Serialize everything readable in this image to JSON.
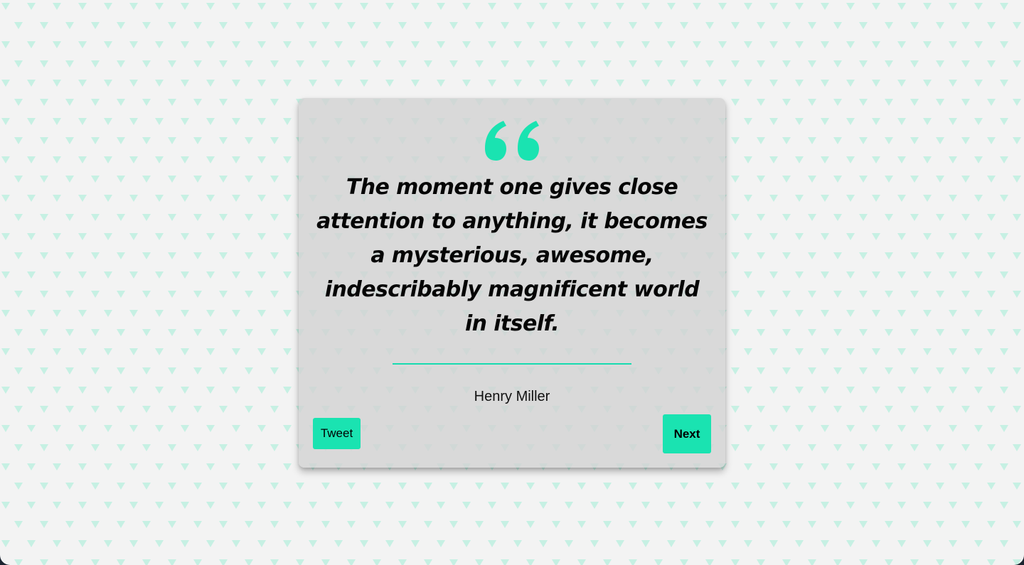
{
  "quote": {
    "icon": "quote-open-icon",
    "text": "The moment one gives close attention to anything, it becomes a mysterious, awesome, indescribably magnificent world in itself.",
    "author": "Henry Miller"
  },
  "actions": {
    "tweet_label": "Tweet",
    "next_label": "Next"
  },
  "colors": {
    "accent": "#1ae3b1",
    "background": "#f3f3f3",
    "pattern": "#c6f0e3",
    "card": "#d6d6d6"
  },
  "background_pattern": "triangle-pattern"
}
